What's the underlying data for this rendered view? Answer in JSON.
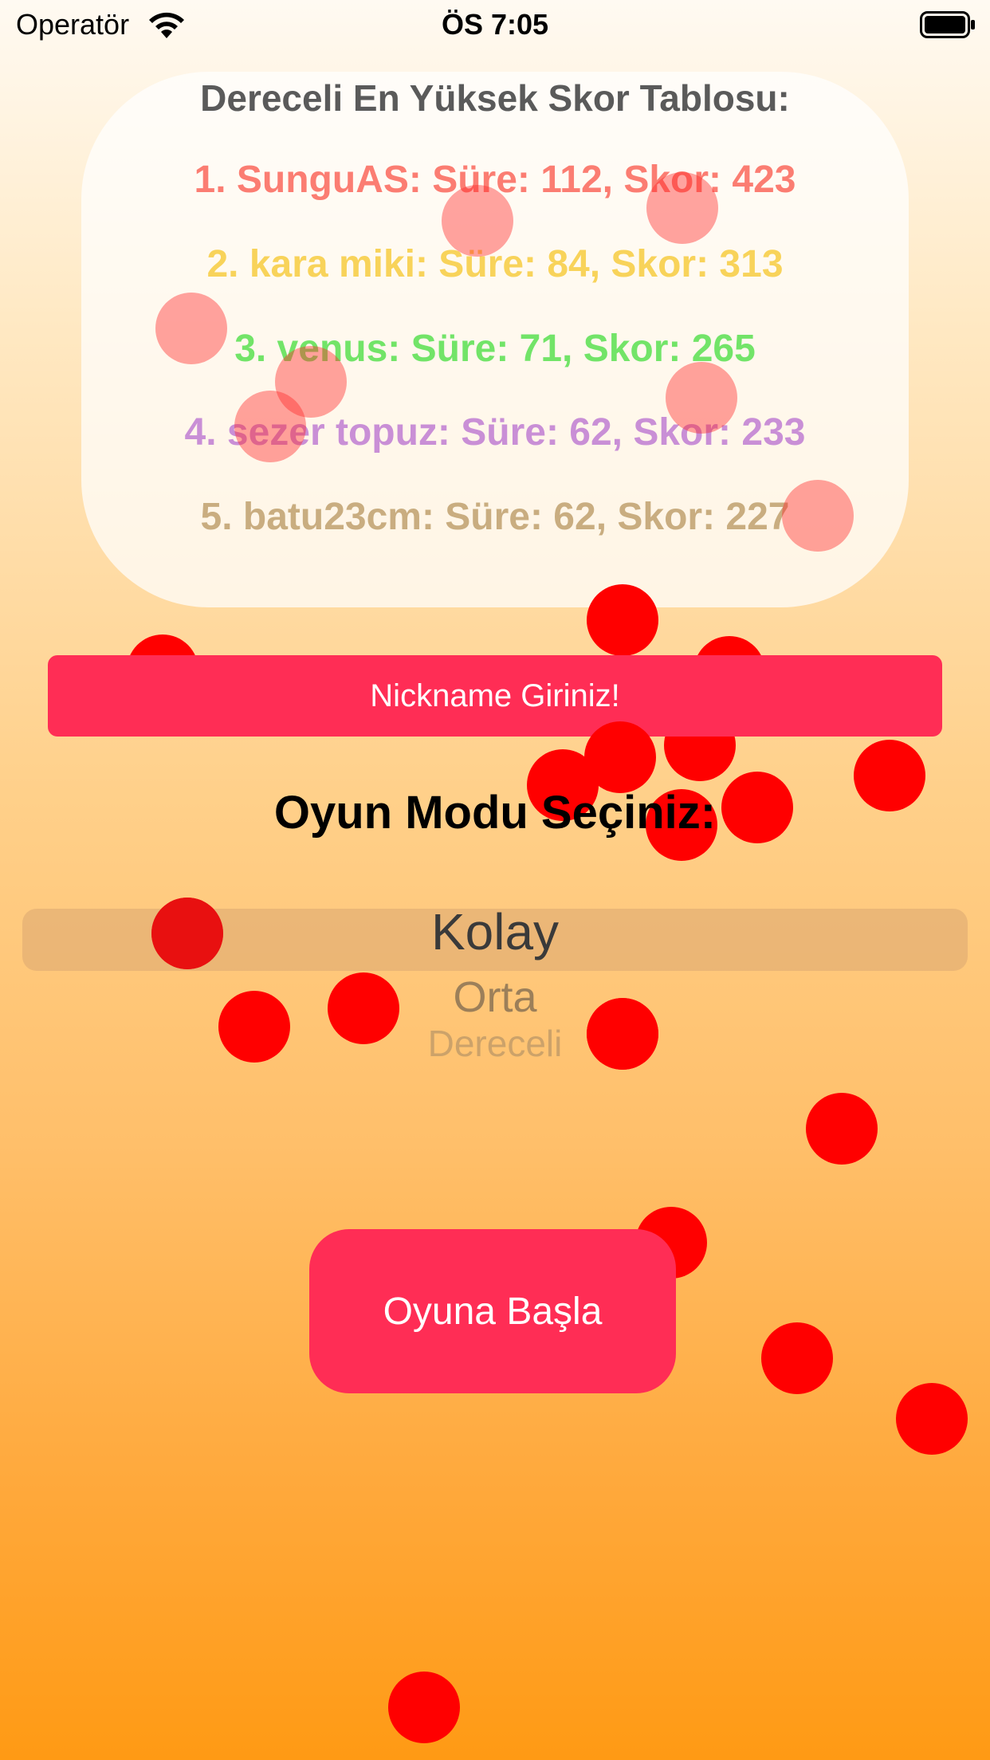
{
  "status_bar": {
    "carrier": "Operatör",
    "time": "ÖS 7:05",
    "wifi_icon": "wifi-icon",
    "battery_icon": "battery-icon"
  },
  "leaderboard": {
    "title": "Dereceli En Yüksek Skor Tablosu:",
    "rows": [
      {
        "text": "1. SunguAS: Süre: 112, Skor: 423",
        "color": "#fb7d72"
      },
      {
        "text": "2. kara miki: Süre: 84, Skor: 313",
        "color": "#f8d35a"
      },
      {
        "text": "3. venus: Süre: 71, Skor: 265",
        "color": "#72e468"
      },
      {
        "text": "4. sezer topuz: Süre: 62, Skor: 233",
        "color": "#c98fd6"
      },
      {
        "text": "5. batu23cm: Süre: 62, Skor: 227",
        "color": "#c9ad80"
      }
    ]
  },
  "nickname_button": {
    "label": "Nickname Giriniz!"
  },
  "mode_title": "Oyun Modu Seçiniz:",
  "mode_picker": {
    "options": [
      "Kolay",
      "Orta",
      "Dereceli"
    ],
    "selected": "Kolay"
  },
  "start_button": {
    "label": "Oyuna Başla"
  },
  "colors": {
    "accent": "#ff2d55",
    "dot": "#ff0000",
    "gradient_top": "#fffaf2",
    "gradient_bottom": "#ff9a14"
  }
}
